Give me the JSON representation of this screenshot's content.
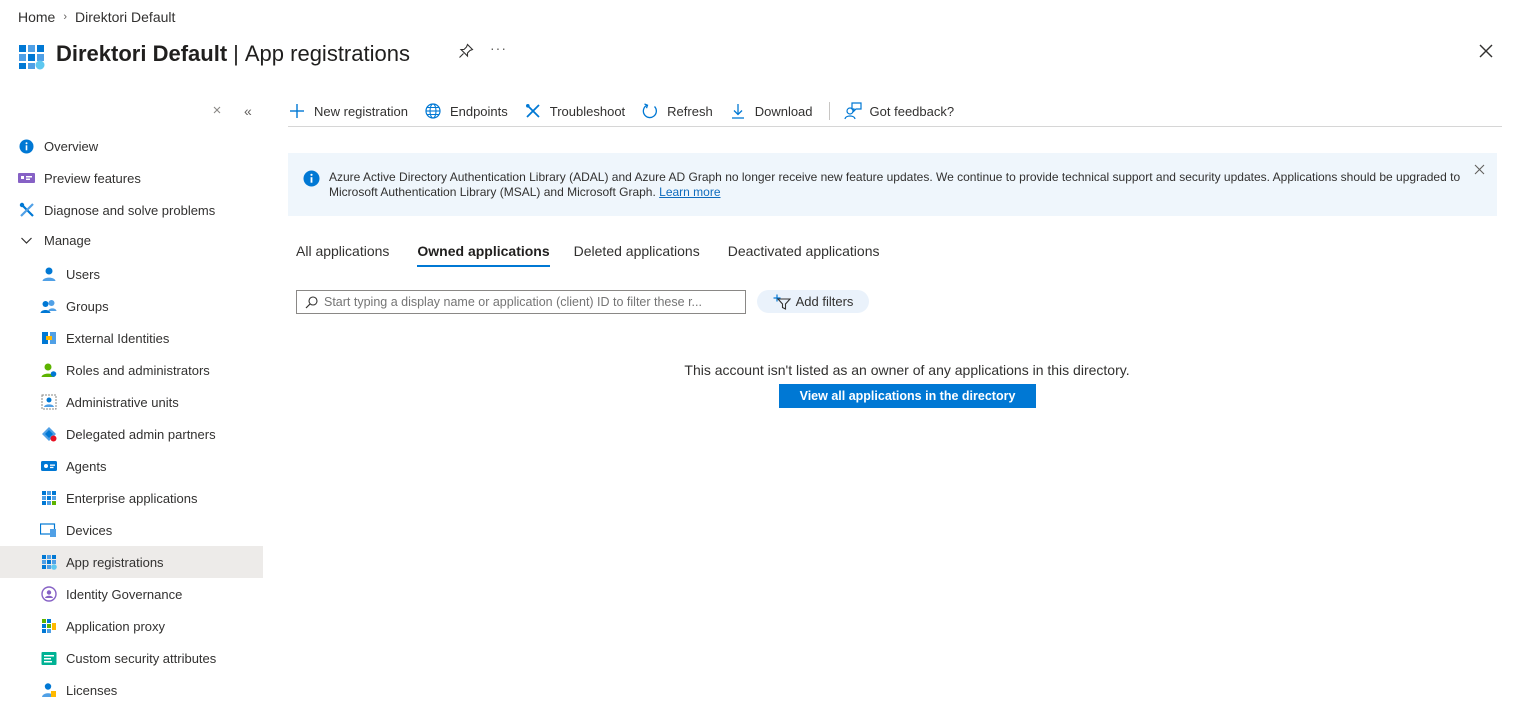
{
  "breadcrumb": {
    "home": "Home",
    "current": "Direktori Default"
  },
  "header": {
    "title_main": "Direktori Default",
    "title_sep": "|",
    "title_sub": "App registrations",
    "more": "···"
  },
  "toolbar": {
    "new_registration": "New registration",
    "endpoints": "Endpoints",
    "troubleshoot": "Troubleshoot",
    "refresh": "Refresh",
    "download": "Download",
    "feedback": "Got feedback?"
  },
  "banner": {
    "text": "Azure Active Directory Authentication Library (ADAL) and Azure AD Graph no longer receive new feature updates. We continue to provide technical support and security updates. Applications should be upgraded to Microsoft Authentication Library (MSAL) and Microsoft Graph.",
    "link": "Learn more"
  },
  "tabs": {
    "all": "All applications",
    "owned": "Owned applications",
    "deleted": "Deleted applications",
    "deactivated": "Deactivated applications"
  },
  "filter": {
    "placeholder": "Start typing a display name or application (client) ID to filter these r...",
    "add_filters": "Add filters"
  },
  "empty": {
    "message": "This account isn't listed as an owner of any applications in this directory.",
    "button": "View all applications in the directory"
  },
  "sidebar": {
    "overview": "Overview",
    "preview": "Preview features",
    "diagnose": "Diagnose and solve problems",
    "manage": "Manage",
    "users": "Users",
    "groups": "Groups",
    "external": "External Identities",
    "roles": "Roles and administrators",
    "admin_units": "Administrative units",
    "delegated": "Delegated admin partners",
    "agents": "Agents",
    "enterprise": "Enterprise applications",
    "devices": "Devices",
    "app_reg": "App registrations",
    "governance": "Identity Governance",
    "app_proxy": "Application proxy",
    "custom_attr": "Custom security attributes",
    "licenses": "Licenses"
  },
  "colors": {
    "accent": "#0078d4",
    "banner_bg": "#eff6fc",
    "active_nav": "#edebe9"
  }
}
